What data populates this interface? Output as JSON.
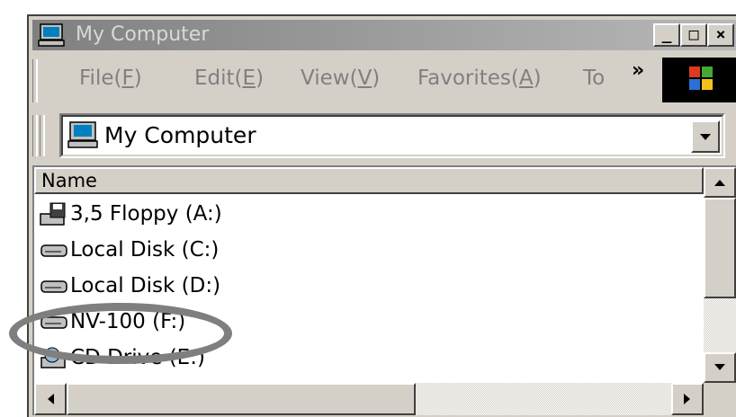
{
  "window": {
    "title": "My Computer",
    "buttons": {
      "minimize": "_",
      "maximize": "□",
      "close": "×"
    }
  },
  "menubar": {
    "items": [
      {
        "label": "File(",
        "key": "F",
        "close": ")"
      },
      {
        "label": "Edit(",
        "key": "E",
        "close": ")"
      },
      {
        "label": "View(",
        "key": "V",
        "close": ")"
      },
      {
        "label": "Favorites(",
        "key": "A",
        "close": ")"
      },
      {
        "label": "To",
        "key": "",
        "close": ""
      }
    ],
    "chevron": "»"
  },
  "address": {
    "value": "My Computer",
    "icon": "computer-icon"
  },
  "list": {
    "column_header": "Name",
    "items": [
      {
        "label": "3,5 Floppy (A:)",
        "icon": "floppy-drive-icon"
      },
      {
        "label": "Local Disk (C:)",
        "icon": "hard-disk-icon"
      },
      {
        "label": "Local Disk (D:)",
        "icon": "hard-disk-icon"
      },
      {
        "label": "NV-100 (F:)",
        "icon": "hard-disk-icon"
      },
      {
        "label": "CD Drive (E:)",
        "icon": "cd-drive-icon"
      }
    ]
  },
  "colors": {
    "highlight_ring": "#7f7f7f",
    "titlebar": "#9a9a9a"
  }
}
